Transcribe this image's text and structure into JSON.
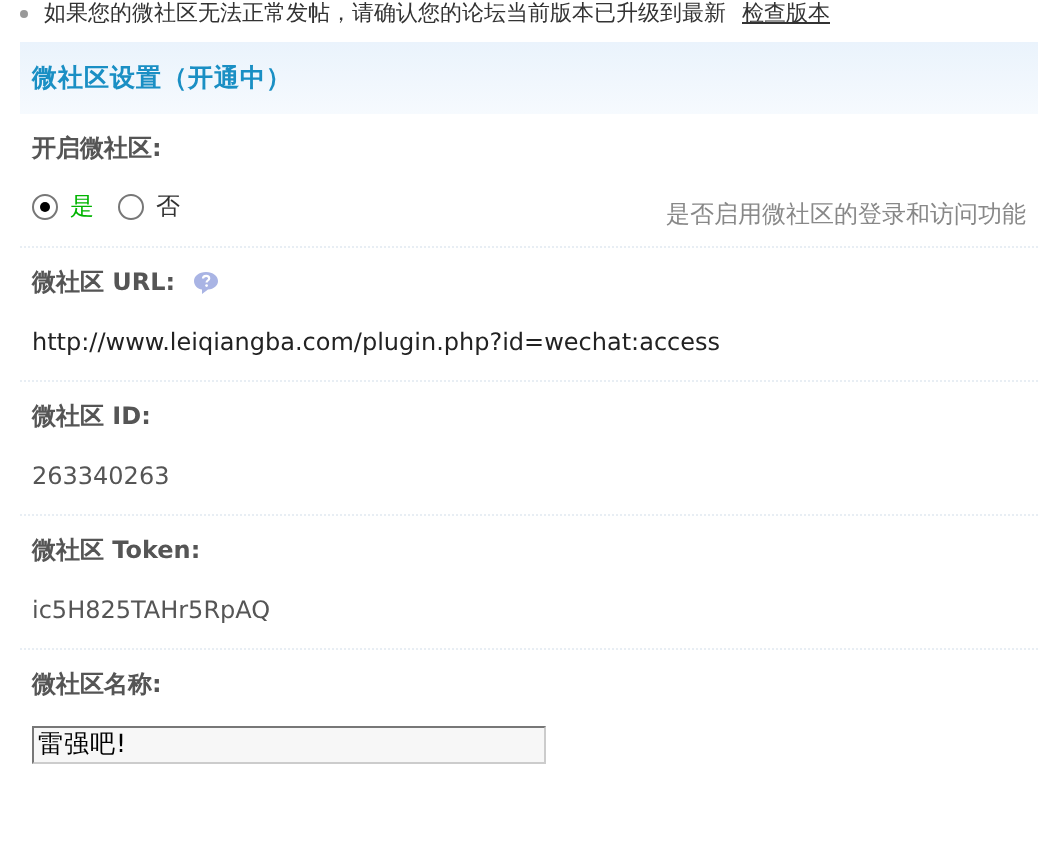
{
  "notice": {
    "text": "如果您的微社区无法正常发帖，请确认您的论坛当前版本已升级到最新",
    "link": "检查版本"
  },
  "section": {
    "title": "微社区设置（开通中）"
  },
  "fields": [
    {
      "kind": "radio",
      "label": "开启微社区:",
      "options": [
        {
          "label": "是",
          "selected": true
        },
        {
          "label": "否",
          "selected": false
        }
      ],
      "hint": "是否启用微社区的登录和访问功能"
    },
    {
      "kind": "text",
      "label": "微社区 URL:",
      "help": true,
      "value": "http://www.leiqiangba.com/plugin.php?id=wechat:access"
    },
    {
      "kind": "text",
      "label": "微社区 ID:",
      "help": false,
      "value": "263340263"
    },
    {
      "kind": "text",
      "label": "微社区 Token:",
      "help": false,
      "value": "ic5H825TAHr5RpAQ"
    },
    {
      "kind": "input",
      "label": "微社区名称:",
      "value": "雷强吧!"
    }
  ]
}
